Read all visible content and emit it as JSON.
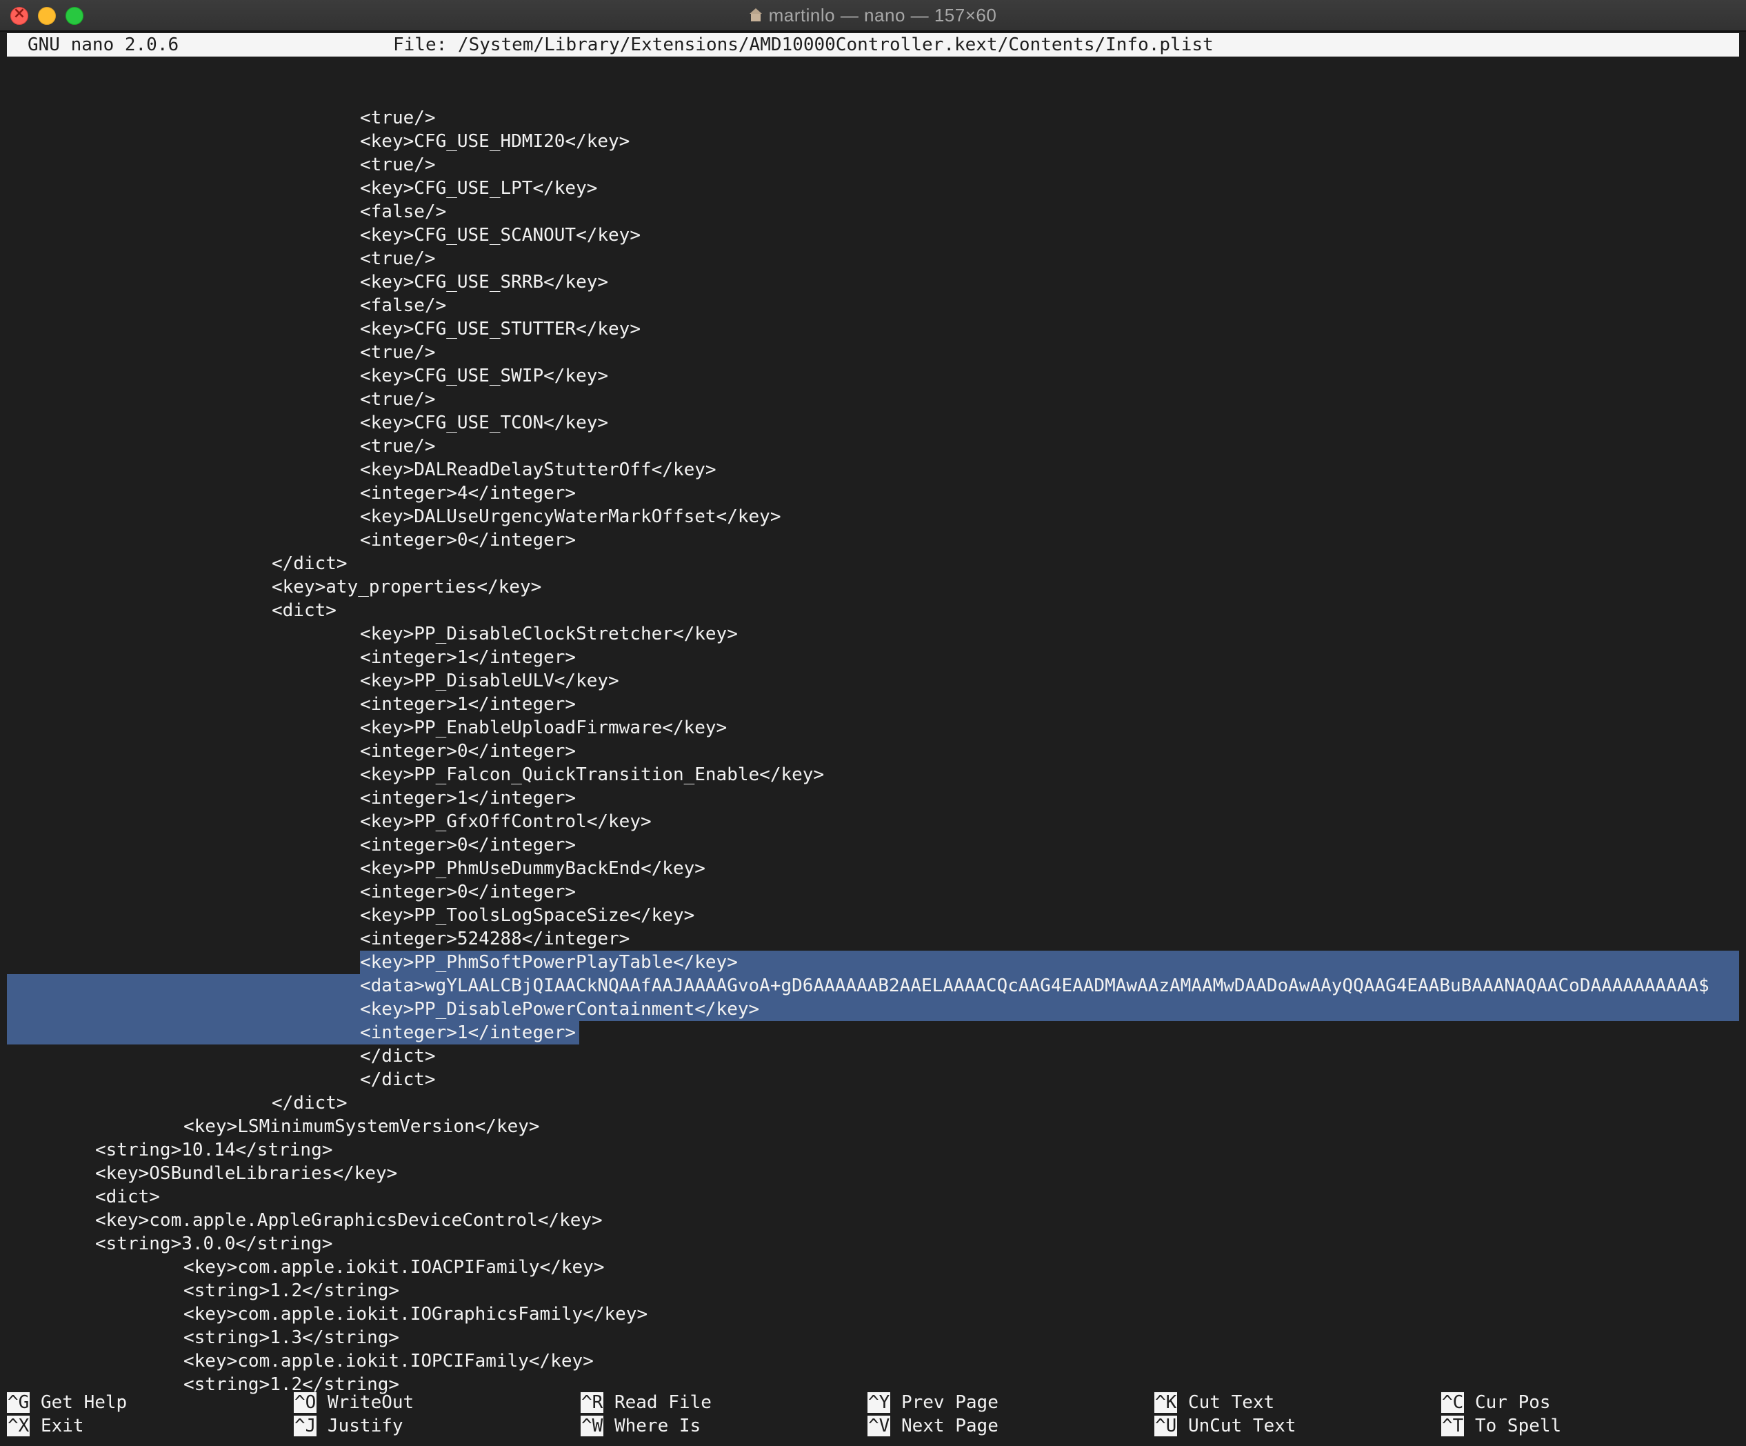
{
  "window": {
    "title": "martinlo — nano — 157×60"
  },
  "header": {
    "version": "GNU nano 2.0.6",
    "file": "File: /System/Library/Extensions/AMD10000Controller.kext/Contents/Info.plist"
  },
  "lines": [
    "<true/>",
    "<key>CFG_USE_HDMI20</key>",
    "<true/>",
    "<key>CFG_USE_LPT</key>",
    "<false/>",
    "<key>CFG_USE_SCANOUT</key>",
    "<true/>",
    "<key>CFG_USE_SRRB</key>",
    "<false/>",
    "<key>CFG_USE_STUTTER</key>",
    "<true/>",
    "<key>CFG_USE_SWIP</key>",
    "<true/>",
    "<key>CFG_USE_TCON</key>",
    "<true/>",
    "<key>DALReadDelayStutterOff</key>",
    "<integer>4</integer>",
    "<key>DALUseUrgencyWaterMarkOffset</key>",
    "<integer>0</integer>",
    "</dict>",
    "<key>aty_properties</key>",
    "<dict>",
    "<key>PP_DisableClockStretcher</key>",
    "<integer>1</integer>",
    "<key>PP_DisableULV</key>",
    "<integer>1</integer>",
    "<key>PP_EnableUploadFirmware</key>",
    "<integer>0</integer>",
    "<key>PP_Falcon_QuickTransition_Enable</key>",
    "<integer>1</integer>",
    "<key>PP_GfxOffControl</key>",
    "<integer>0</integer>",
    "<key>PP_PhmUseDummyBackEnd</key>",
    "<integer>0</integer>",
    "<key>PP_ToolsLogSpaceSize</key>",
    "<integer>524288</integer>",
    "<key>PP_PhmSoftPowerPlayTable</key>",
    "<data>wgYLAALCBjQIAACkNQAAfAAJAAAAGvoA+gD6AAAAAAB2AAELAAAACQcAAG4EAADMAwAAzAMAAMwDAADoAwAAyQQAAG4EAABuBAAANAQAACoDAAAAAAAAAA$",
    "<key>PP_DisablePowerContainment</key>",
    "<integer>1</integer>",
    "</dict>",
    "</dict>",
    "</dict>",
    "<key>LSMinimumSystemVersion</key>",
    "<string>10.14</string>",
    "<key>OSBundleLibraries</key>",
    "<dict>",
    "<key>com.apple.AppleGraphicsDeviceControl</key>",
    "<string>3.0.0</string>",
    "<key>com.apple.iokit.IOACPIFamily</key>",
    "<string>1.2</string>",
    "<key>com.apple.iokit.IOGraphicsFamily</key>",
    "<string>1.3</string>",
    "<key>com.apple.iokit.IOPCIFamily</key>",
    "<string>1.2</string>"
  ],
  "shortcuts": [
    {
      "key": "^G",
      "label": "Get Help"
    },
    {
      "key": "^O",
      "label": "WriteOut"
    },
    {
      "key": "^R",
      "label": "Read File"
    },
    {
      "key": "^Y",
      "label": "Prev Page"
    },
    {
      "key": "^K",
      "label": "Cut Text"
    },
    {
      "key": "^C",
      "label": "Cur Pos"
    },
    {
      "key": "^X",
      "label": "Exit"
    },
    {
      "key": "^J",
      "label": "Justify"
    },
    {
      "key": "^W",
      "label": "Where Is"
    },
    {
      "key": "^V",
      "label": "Next Page"
    },
    {
      "key": "^U",
      "label": "UnCut Text"
    },
    {
      "key": "^T",
      "label": "To Spell"
    }
  ]
}
